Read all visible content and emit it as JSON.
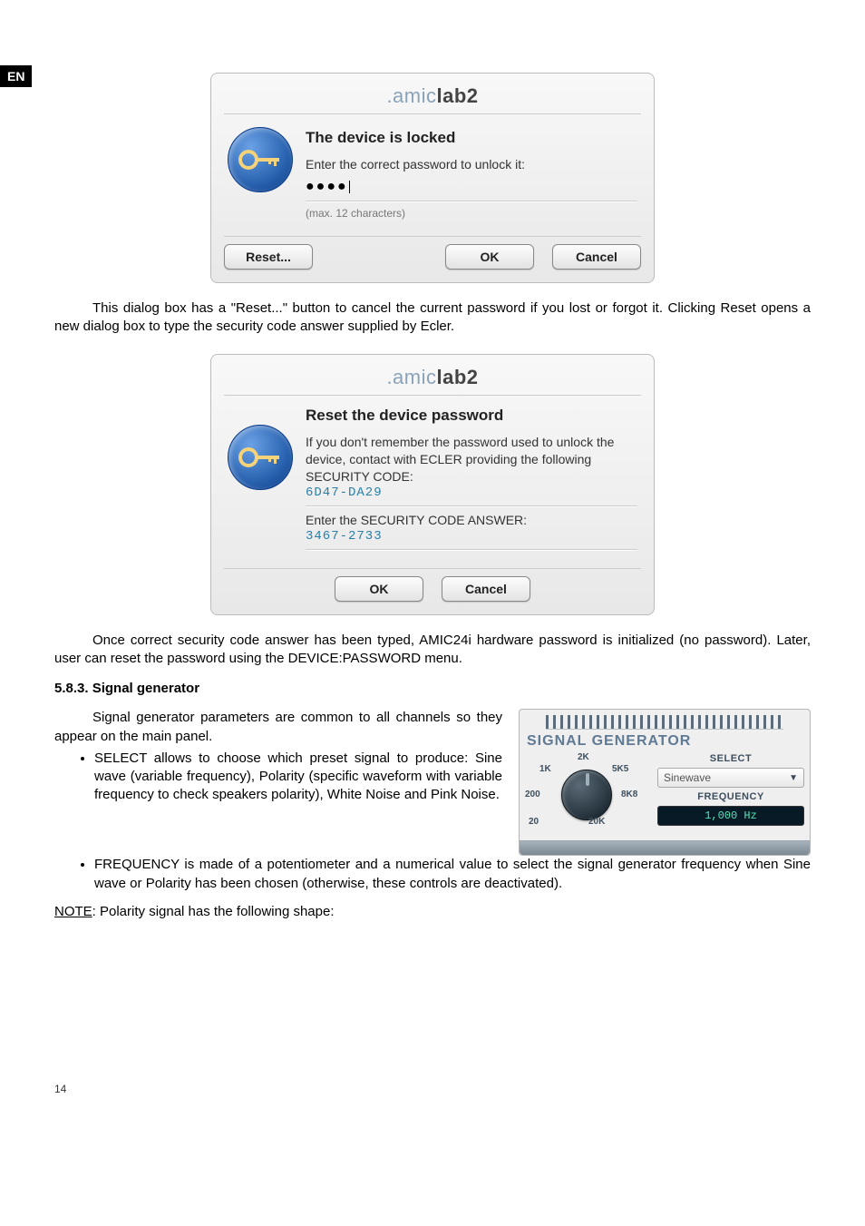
{
  "langBadge": "EN",
  "dialog1": {
    "title_pre": ".amic",
    "title_mid": "lab",
    "title_bold": "2",
    "heading": "The device is locked",
    "prompt": "Enter the correct password to unlock it:",
    "password_mask": "●●●●",
    "max_note": "(max. 12 characters)",
    "btn_reset": "Reset...",
    "btn_ok": "OK",
    "btn_cancel": "Cancel"
  },
  "para1": "This dialog box has a \"Reset...\" button to cancel the current password if you lost or forgot it. Clicking Reset opens a new dialog box to type the security code answer supplied by Ecler.",
  "dialog2": {
    "title_pre": ".amic",
    "title_mid": "lab",
    "title_bold": "2",
    "heading": "Reset the device password",
    "text1": "If you don't remember the password used to unlock the device, contact with ECLER providing the following SECURITY CODE:",
    "code1": "6D47-DA29",
    "text2": "Enter the SECURITY CODE ANSWER:",
    "code2": "3467-2733",
    "btn_ok": "OK",
    "btn_cancel": "Cancel"
  },
  "para2": "Once correct security code answer has been typed, AMIC24i hardware password is initialized (no password). Later, user can reset the password using the DEVICE:PASSWORD menu.",
  "section_heading": "5.8.3. Signal generator",
  "para3": "Signal generator parameters are common to all channels so they appear on the main panel.",
  "bullet1": "SELECT allows to choose which preset signal to produce: Sine wave (variable frequency), Polarity (specific waveform with variable frequency to check speakers polarity), White Noise and Pink Noise.",
  "bullet2": "FREQUENCY is made of a potentiometer and a numerical value to select the signal generator frequency when Sine wave or Polarity has been chosen (otherwise, these controls are deactivated).",
  "sig": {
    "title": "SIGNAL GENERATOR",
    "k20": "20",
    "k200": "200",
    "k1k": "1K",
    "k2k": "2K",
    "k5k5": "5K5",
    "k8k8": "8K8",
    "k20k": "20K",
    "select_h": "SELECT",
    "select_val": "Sinewave",
    "freq_h": "FREQUENCY",
    "freq_val": "1,000 Hz"
  },
  "note_label": "NOTE",
  "note_text": ": Polarity signal has the following shape:",
  "page_number": "14"
}
